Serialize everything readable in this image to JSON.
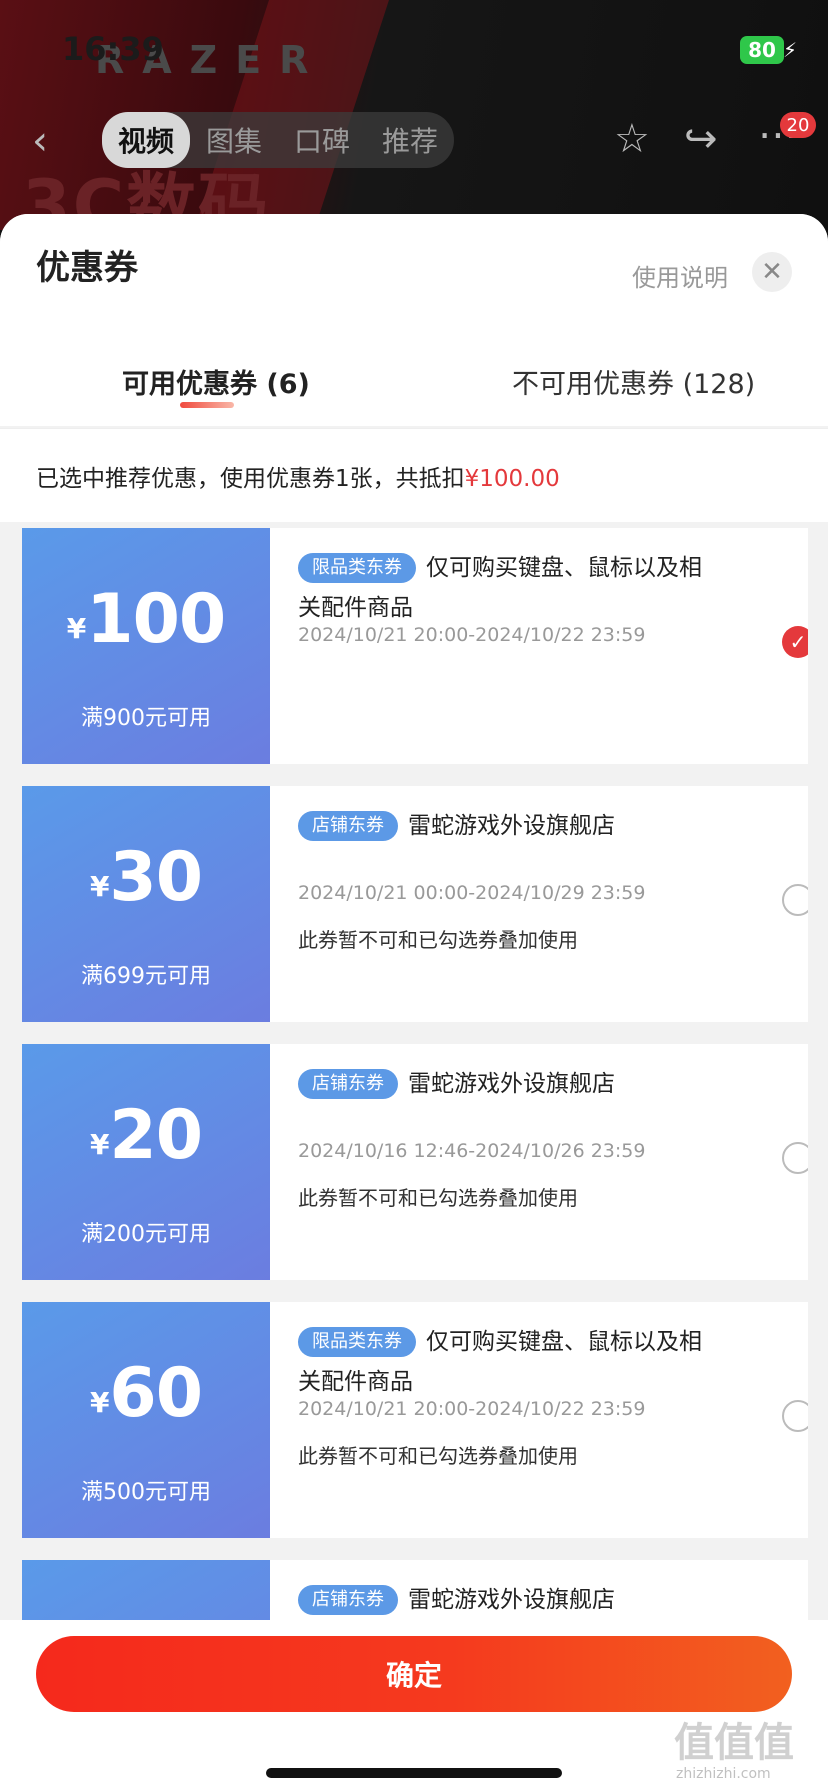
{
  "status_bar": {
    "time": "16:39",
    "battery": "80"
  },
  "background": {
    "brand": "RAZER",
    "banner_text": "3C数码"
  },
  "nav": {
    "tabs": [
      "视频",
      "图集",
      "口碑",
      "推荐"
    ],
    "active_tab": "视频",
    "badge": "20"
  },
  "sheet": {
    "title": "优惠券",
    "usage_link": "使用说明",
    "close_icon": "close-icon",
    "tabs": {
      "available": "可用优惠券 (6)",
      "unavailable": "不可用优惠券 (128)"
    },
    "summary": {
      "text": "已选中推荐优惠，使用优惠券1张，共抵扣",
      "amount": "¥100.00"
    }
  },
  "coupons": [
    {
      "currency": "¥",
      "value": "100",
      "condition": "满900元可用",
      "tag": "限品类东券",
      "desc_lead": "仅可购买键盘、鼠标以及相",
      "desc_rest": "关配件商品",
      "date": "2024/10/21 20:00-2024/10/22 23:59",
      "note": "",
      "checked": true
    },
    {
      "currency": "¥",
      "value": "30",
      "condition": "满699元可用",
      "tag": "店铺东券",
      "desc_lead": "雷蛇游戏外设旗舰店",
      "desc_rest": "",
      "date": "2024/10/21 00:00-2024/10/29 23:59",
      "note": "此券暂不可和已勾选券叠加使用",
      "checked": false
    },
    {
      "currency": "¥",
      "value": "20",
      "condition": "满200元可用",
      "tag": "店铺东券",
      "desc_lead": "雷蛇游戏外设旗舰店",
      "desc_rest": "",
      "date": "2024/10/16 12:46-2024/10/26 23:59",
      "note": "此券暂不可和已勾选券叠加使用",
      "checked": false
    },
    {
      "currency": "¥",
      "value": "60",
      "condition": "满500元可用",
      "tag": "限品类东券",
      "desc_lead": "仅可购买键盘、鼠标以及相",
      "desc_rest": "关配件商品",
      "date": "2024/10/21 20:00-2024/10/22 23:59",
      "note": "此券暂不可和已勾选券叠加使用",
      "checked": false
    },
    {
      "currency": "¥",
      "value": "",
      "condition": "",
      "tag": "店铺东券",
      "desc_lead": "雷蛇游戏外设旗舰店",
      "desc_rest": "",
      "date": "",
      "note": "",
      "checked": false
    }
  ],
  "footer": {
    "confirm_label": "确定"
  },
  "watermark": {
    "main": "值值值",
    "sub": "zhizhizhi.com"
  },
  "colors": {
    "accent_red": "#e4393c",
    "coupon_blue": "#5a9ae9",
    "coupon_purple": "#6b7de0"
  }
}
